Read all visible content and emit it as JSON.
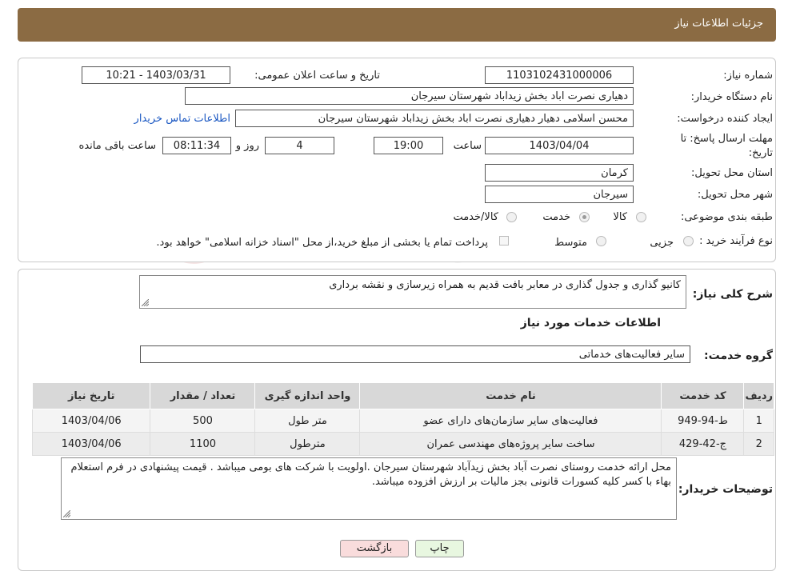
{
  "header": {
    "title": "جزئیات اطلاعات نیاز"
  },
  "form": {
    "need_number_label": "شماره نیاز:",
    "need_number": "1103102431000006",
    "announce_label": "تاریخ و ساعت اعلان عمومی:",
    "announce_value": "1403/03/31 - 10:21",
    "buyer_label": "نام دستگاه خریدار:",
    "buyer_value": "دهیاری نصرت اباد بخش زیداباد شهرستان سیرجان",
    "creator_label": "ایجاد کننده درخواست:",
    "creator_value": "محسن اسلامی دهیار دهیاری نصرت اباد بخش زیداباد شهرستان سیرجان",
    "contact_link": "اطلاعات تماس خریدار",
    "deadline_label_1": "مهلت ارسال پاسخ: تا",
    "deadline_label_2": "تاریخ:",
    "deadline_date": "1403/04/04",
    "time_label": "ساعت",
    "deadline_time": "19:00",
    "days_value": "4",
    "days_label": "روز و",
    "remaining_time": "08:11:34",
    "remaining_label": "ساعت باقی مانده",
    "province_label": "استان محل تحویل:",
    "province_value": "کرمان",
    "city_label": "شهر محل تحویل:",
    "city_value": "سیرجان",
    "category_label": "طبقه بندی موضوعی:",
    "category_options": [
      "کالا",
      "خدمت",
      "کالا/خدمت"
    ],
    "category_selected": "خدمت",
    "purchase_type_label": "نوع فرآیند خرید :",
    "purchase_options": [
      "جزیی",
      "متوسط"
    ],
    "payment_note": "پرداخت تمام یا بخشی از مبلغ خرید،از محل \"اسناد خزانه اسلامی\" خواهد بود."
  },
  "details": {
    "summary_label": "شرح کلی نیاز:",
    "summary_value": "کانیو گذاری و جدول گذاری در معابر بافت قدیم به همراه زیرسازی و نقشه برداری",
    "services_heading": "اطلاعات خدمات مورد نیاز",
    "service_group_label": "گروه خدمت:",
    "service_group_value": "سایر فعالیت‌های خدماتی",
    "table": {
      "headers": [
        "ردیف",
        "کد خدمت",
        "نام خدمت",
        "واحد اندازه گیری",
        "تعداد / مقدار",
        "تاریخ نیاز"
      ],
      "rows": [
        [
          "1",
          "ط-94-949",
          "فعالیت‌های سایر سازمان‌های دارای عضو",
          "متر طول",
          "500",
          "1403/04/06"
        ],
        [
          "2",
          "ج-42-429",
          "ساخت سایر پروژه‌های مهندسی عمران",
          "مترطول",
          "1100",
          "1403/04/06"
        ]
      ]
    },
    "buyer_notes_label": "توضیحات خریدار:",
    "buyer_notes_value": "محل ارائه خدمت روستای نصرت آباد بخش زیدآباد شهرستان سیرجان .اولویت با شرکت های بومی میباشد . قیمت پیشنهادی در فرم استعلام بهاء با کسر کلیه کسورات قانونی بجز مالیات بر ارزش افزوده میباشد."
  },
  "buttons": {
    "print": "چاپ",
    "back": "بازگشت"
  },
  "colors": {
    "header": "#8b6b43",
    "link": "#1a57c2",
    "back_button": "#f9dcdc",
    "print_button": "#e8f7e0"
  }
}
